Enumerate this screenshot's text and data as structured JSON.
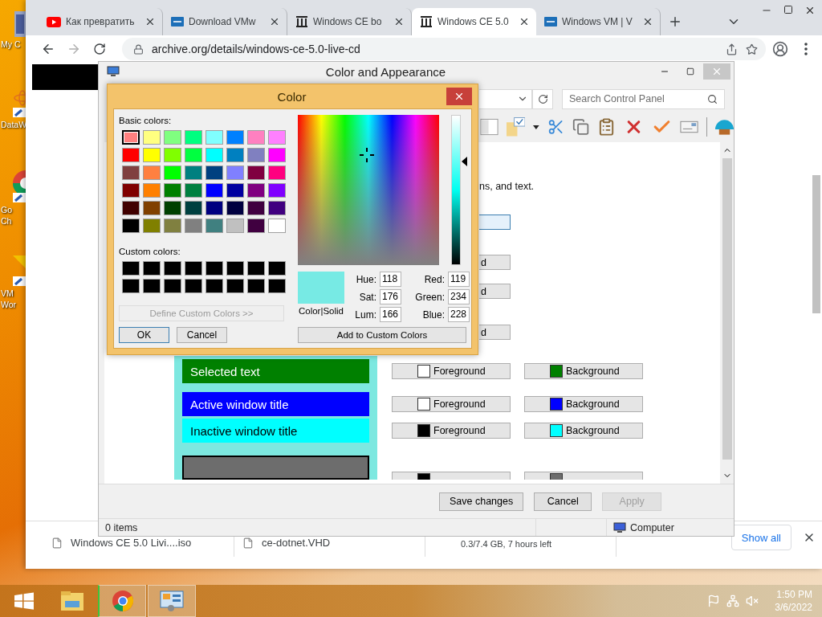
{
  "desktop": {
    "icons": [
      {
        "kind": "computer",
        "label": [
          "My C"
        ]
      },
      {
        "kind": "atom",
        "label": [
          "DataW"
        ]
      },
      {
        "kind": "chrome",
        "label": [
          "Go",
          "Ch"
        ]
      },
      {
        "kind": "vm",
        "label": [
          "VM",
          "Wor"
        ]
      }
    ]
  },
  "browser": {
    "tabs": [
      {
        "kind": "video",
        "title": "Как превратить",
        "selected": false
      },
      {
        "kind": "vm",
        "title": "Download VMw",
        "selected": false
      },
      {
        "kind": "archive",
        "title": "Windows CE bo",
        "selected": false
      },
      {
        "kind": "archive",
        "title": "Windows CE 5.0",
        "selected": true
      },
      {
        "kind": "vm",
        "title": "Windows VM | V",
        "selected": false
      }
    ],
    "address": "archive.org/details/windows-ce-5.0-live-cd",
    "downloads": [
      {
        "kind": "file",
        "text": "Windows CE 5.0 Livi....iso"
      },
      {
        "kind": "file",
        "text": "ce-dotnet.VHD"
      },
      {
        "kind": "progress",
        "text": "0.3/7.4 GB, 7 hours left"
      }
    ],
    "show_all": "Show all"
  },
  "control_panel": {
    "title": "Color and Appearance",
    "search_placeholder": "Search Control Panel",
    "intro": "ns, and text.",
    "stub_buttons": [
      {
        "focused": true
      },
      {
        "label": "d",
        "focused": false
      },
      {
        "label": "d",
        "focused": false
      },
      {
        "label": "d",
        "focused": false
      }
    ],
    "rows": [
      {
        "kind": "bar",
        "label": "Selected text",
        "foreground": {
          "label": "Foreground",
          "color": "#ffffff"
        },
        "background": {
          "label": "Background",
          "color": "#008000"
        }
      },
      {
        "kind": "bar",
        "label": "Active window title",
        "foreground": {
          "label": "Foreground",
          "color": "#ffffff"
        },
        "background": {
          "label": "Background",
          "color": "#0000ff"
        }
      },
      {
        "kind": "bar",
        "label": "Inactive window title",
        "foreground": {
          "label": "Foreground",
          "color": "#000000"
        },
        "background": {
          "label": "Background",
          "color": "#00ffff"
        }
      },
      {
        "kind": "cut",
        "foreground": {
          "color": "#000000"
        },
        "background": {
          "color": "#6d6d6d"
        }
      }
    ],
    "buttons": [
      {
        "label": "Save changes",
        "disabled": false
      },
      {
        "label": "Cancel",
        "disabled": false
      },
      {
        "label": "Apply",
        "disabled": true
      }
    ],
    "status": {
      "count": "0 items",
      "location": "Computer"
    }
  },
  "color_dialog": {
    "title": "Color",
    "basic_label": "Basic colors:",
    "basic_colors": [
      {
        "color": "#ff8080",
        "selected": true
      },
      {
        "color": "#ffff80",
        "selected": false
      },
      {
        "color": "#80ff80",
        "selected": false
      },
      {
        "color": "#00ff80",
        "selected": false
      },
      {
        "color": "#80ffff",
        "selected": false
      },
      {
        "color": "#0080ff",
        "selected": false
      },
      {
        "color": "#ff80c0",
        "selected": false
      },
      {
        "color": "#ff80ff",
        "selected": false
      },
      {
        "color": "#ff0000",
        "selected": false
      },
      {
        "color": "#ffff00",
        "selected": false
      },
      {
        "color": "#80ff00",
        "selected": false
      },
      {
        "color": "#00ff40",
        "selected": false
      },
      {
        "color": "#00ffff",
        "selected": false
      },
      {
        "color": "#0080c0",
        "selected": false
      },
      {
        "color": "#8080c0",
        "selected": false
      },
      {
        "color": "#ff00ff",
        "selected": false
      },
      {
        "color": "#804040",
        "selected": false
      },
      {
        "color": "#ff8040",
        "selected": false
      },
      {
        "color": "#00ff00",
        "selected": false
      },
      {
        "color": "#008080",
        "selected": false
      },
      {
        "color": "#004080",
        "selected": false
      },
      {
        "color": "#8080ff",
        "selected": false
      },
      {
        "color": "#800040",
        "selected": false
      },
      {
        "color": "#ff0080",
        "selected": false
      },
      {
        "color": "#800000",
        "selected": false
      },
      {
        "color": "#ff8000",
        "selected": false
      },
      {
        "color": "#008000",
        "selected": false
      },
      {
        "color": "#008040",
        "selected": false
      },
      {
        "color": "#0000ff",
        "selected": false
      },
      {
        "color": "#0000a0",
        "selected": false
      },
      {
        "color": "#800080",
        "selected": false
      },
      {
        "color": "#8000ff",
        "selected": false
      },
      {
        "color": "#400000",
        "selected": false
      },
      {
        "color": "#804000",
        "selected": false
      },
      {
        "color": "#004000",
        "selected": false
      },
      {
        "color": "#004040",
        "selected": false
      },
      {
        "color": "#000080",
        "selected": false
      },
      {
        "color": "#000040",
        "selected": false
      },
      {
        "color": "#400040",
        "selected": false
      },
      {
        "color": "#400080",
        "selected": false
      },
      {
        "color": "#000000",
        "selected": false
      },
      {
        "color": "#808000",
        "selected": false
      },
      {
        "color": "#808040",
        "selected": false
      },
      {
        "color": "#808080",
        "selected": false
      },
      {
        "color": "#408080",
        "selected": false
      },
      {
        "color": "#c0c0c0",
        "selected": false
      },
      {
        "color": "#400040",
        "selected": false
      },
      {
        "color": "#ffffff",
        "selected": false
      }
    ],
    "custom_label": "Custom colors:",
    "custom_colors": [
      {
        "color": "#000000"
      },
      {
        "color": "#000000"
      },
      {
        "color": "#000000"
      },
      {
        "color": "#000000"
      },
      {
        "color": "#000000"
      },
      {
        "color": "#000000"
      },
      {
        "color": "#000000"
      },
      {
        "color": "#000000"
      },
      {
        "color": "#000000"
      },
      {
        "color": "#000000"
      },
      {
        "color": "#000000"
      },
      {
        "color": "#000000"
      },
      {
        "color": "#000000"
      },
      {
        "color": "#000000"
      },
      {
        "color": "#000000"
      },
      {
        "color": "#000000"
      }
    ],
    "define_button": {
      "label": "Define Custom Colors >>",
      "disabled": true
    },
    "ok": "OK",
    "cancel": "Cancel",
    "luminance": {
      "level": 0.69
    },
    "preview": {
      "color": "#77eae4",
      "label": "Color|Solid"
    },
    "fields": [
      {
        "label": "Hue:",
        "value": "118"
      },
      {
        "label": "Red:",
        "value": "119"
      },
      {
        "label": "Sat:",
        "value": "176"
      },
      {
        "label": "Green:",
        "value": "234"
      },
      {
        "label": "Lum:",
        "value": "166"
      },
      {
        "label": "Blue:",
        "value": "228"
      }
    ],
    "add_button": "Add to Custom Colors"
  },
  "taskbar": {
    "apps": [
      {
        "kind": "explorer",
        "selected": false
      },
      {
        "kind": "chrome",
        "selected": true
      },
      {
        "kind": "control-panel",
        "selected": true
      }
    ],
    "clock": {
      "time": "1:50 PM",
      "date": "3/6/2022"
    }
  }
}
